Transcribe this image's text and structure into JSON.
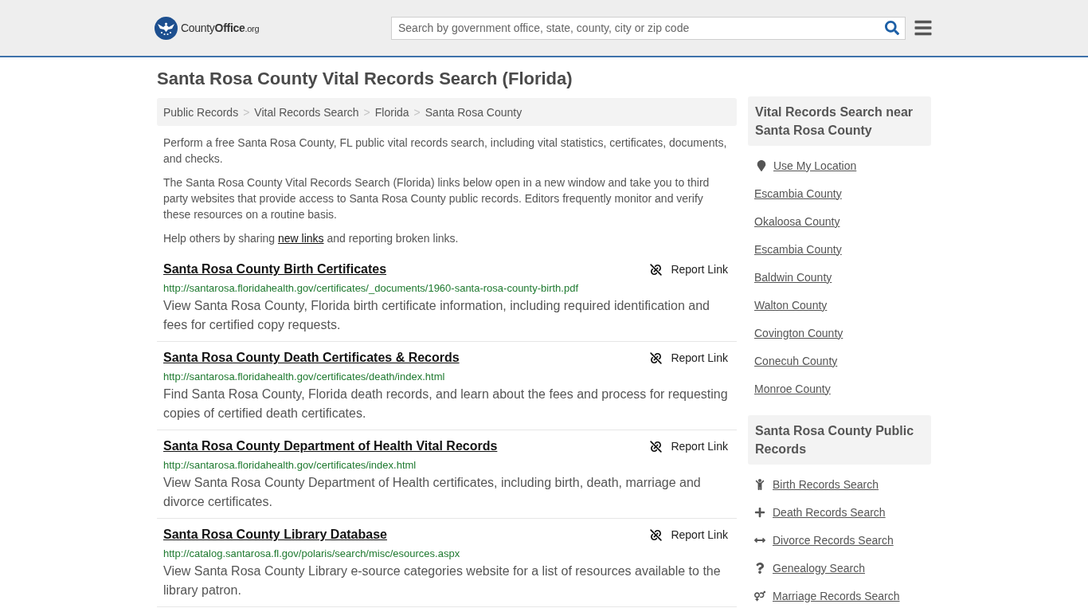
{
  "header": {
    "logo": [
      {
        "text": "County",
        "kind": "regular"
      },
      {
        "text": "Office",
        "kind": "bold"
      },
      {
        "text": ".org",
        "kind": "small"
      }
    ],
    "search": {
      "placeholder": "Search by government office, state, county, city or zip code"
    }
  },
  "page_title": "Santa Rosa County Vital Records Search (Florida)",
  "breadcrumb": {
    "separator": ">",
    "items": [
      "Public Records",
      "Vital Records Search",
      "Florida",
      "Santa Rosa County"
    ]
  },
  "intro": [
    {
      "kind": "text",
      "text": "Perform a free Santa Rosa County, FL public vital records search, including vital statistics, certificates, documents, and checks."
    },
    {
      "kind": "text",
      "text": "The Santa Rosa County Vital Records Search (Florida) links below open in a new window and take you to third party websites that provide access to Santa Rosa County public records. Editors frequently monitor and verify these resources on a routine basis."
    },
    {
      "kind": "with_link",
      "before": "Help others by sharing",
      "link": "new links",
      "after": "and reporting broken links."
    }
  ],
  "results": [
    {
      "title": "Santa Rosa County Birth Certificates",
      "report_label": "Report Link",
      "url": "http://santarosa.floridahealth.gov/certificates/_documents/1960-santa-rosa-county-birth.pdf",
      "description": "View Santa Rosa County, Florida birth certificate information, including required identification and fees for certified copy requests."
    },
    {
      "title": "Santa Rosa County Death Certificates & Records",
      "report_label": "Report Link",
      "url": "http://santarosa.floridahealth.gov/certificates/death/index.html",
      "description": "Find Santa Rosa County, Florida death records, and learn about the fees and process for requesting copies of certified death certificates."
    },
    {
      "title": "Santa Rosa County Department of Health Vital Records",
      "report_label": "Report Link",
      "url": "http://santarosa.floridahealth.gov/certificates/index.html",
      "description": "View Santa Rosa County Department of Health certificates, including birth, death, marriage and divorce certificates."
    },
    {
      "title": "Santa Rosa County Library Database",
      "report_label": "Report Link",
      "url": "http://catalog.santarosa.fl.gov/polaris/search/misc/esources.aspx",
      "description": "View Santa Rosa County Library e-source categories website for a list of resources available to the library patron."
    }
  ],
  "sidebar": [
    {
      "heading": "Vital Records Search near Santa Rosa County",
      "items": [
        {
          "label": "Use My Location",
          "kind": "location"
        },
        {
          "label": "Escambia County",
          "kind": "place"
        },
        {
          "label": "Okaloosa County",
          "kind": "place"
        },
        {
          "label": "Escambia County",
          "kind": "place"
        },
        {
          "label": "Baldwin County",
          "kind": "place"
        },
        {
          "label": "Walton County",
          "kind": "place"
        },
        {
          "label": "Covington County",
          "kind": "place"
        },
        {
          "label": "Conecuh County",
          "kind": "place"
        },
        {
          "label": "Monroe County",
          "kind": "place"
        }
      ]
    },
    {
      "heading": "Santa Rosa County Public Records",
      "items": [
        {
          "label": "Birth Records Search",
          "kind": "birth"
        },
        {
          "label": "Death Records Search",
          "kind": "death"
        },
        {
          "label": "Divorce Records Search",
          "kind": "divorce"
        },
        {
          "label": "Genealogy Search",
          "kind": "genealogy"
        },
        {
          "label": "Marriage Records Search",
          "kind": "marriage"
        }
      ]
    }
  ]
}
